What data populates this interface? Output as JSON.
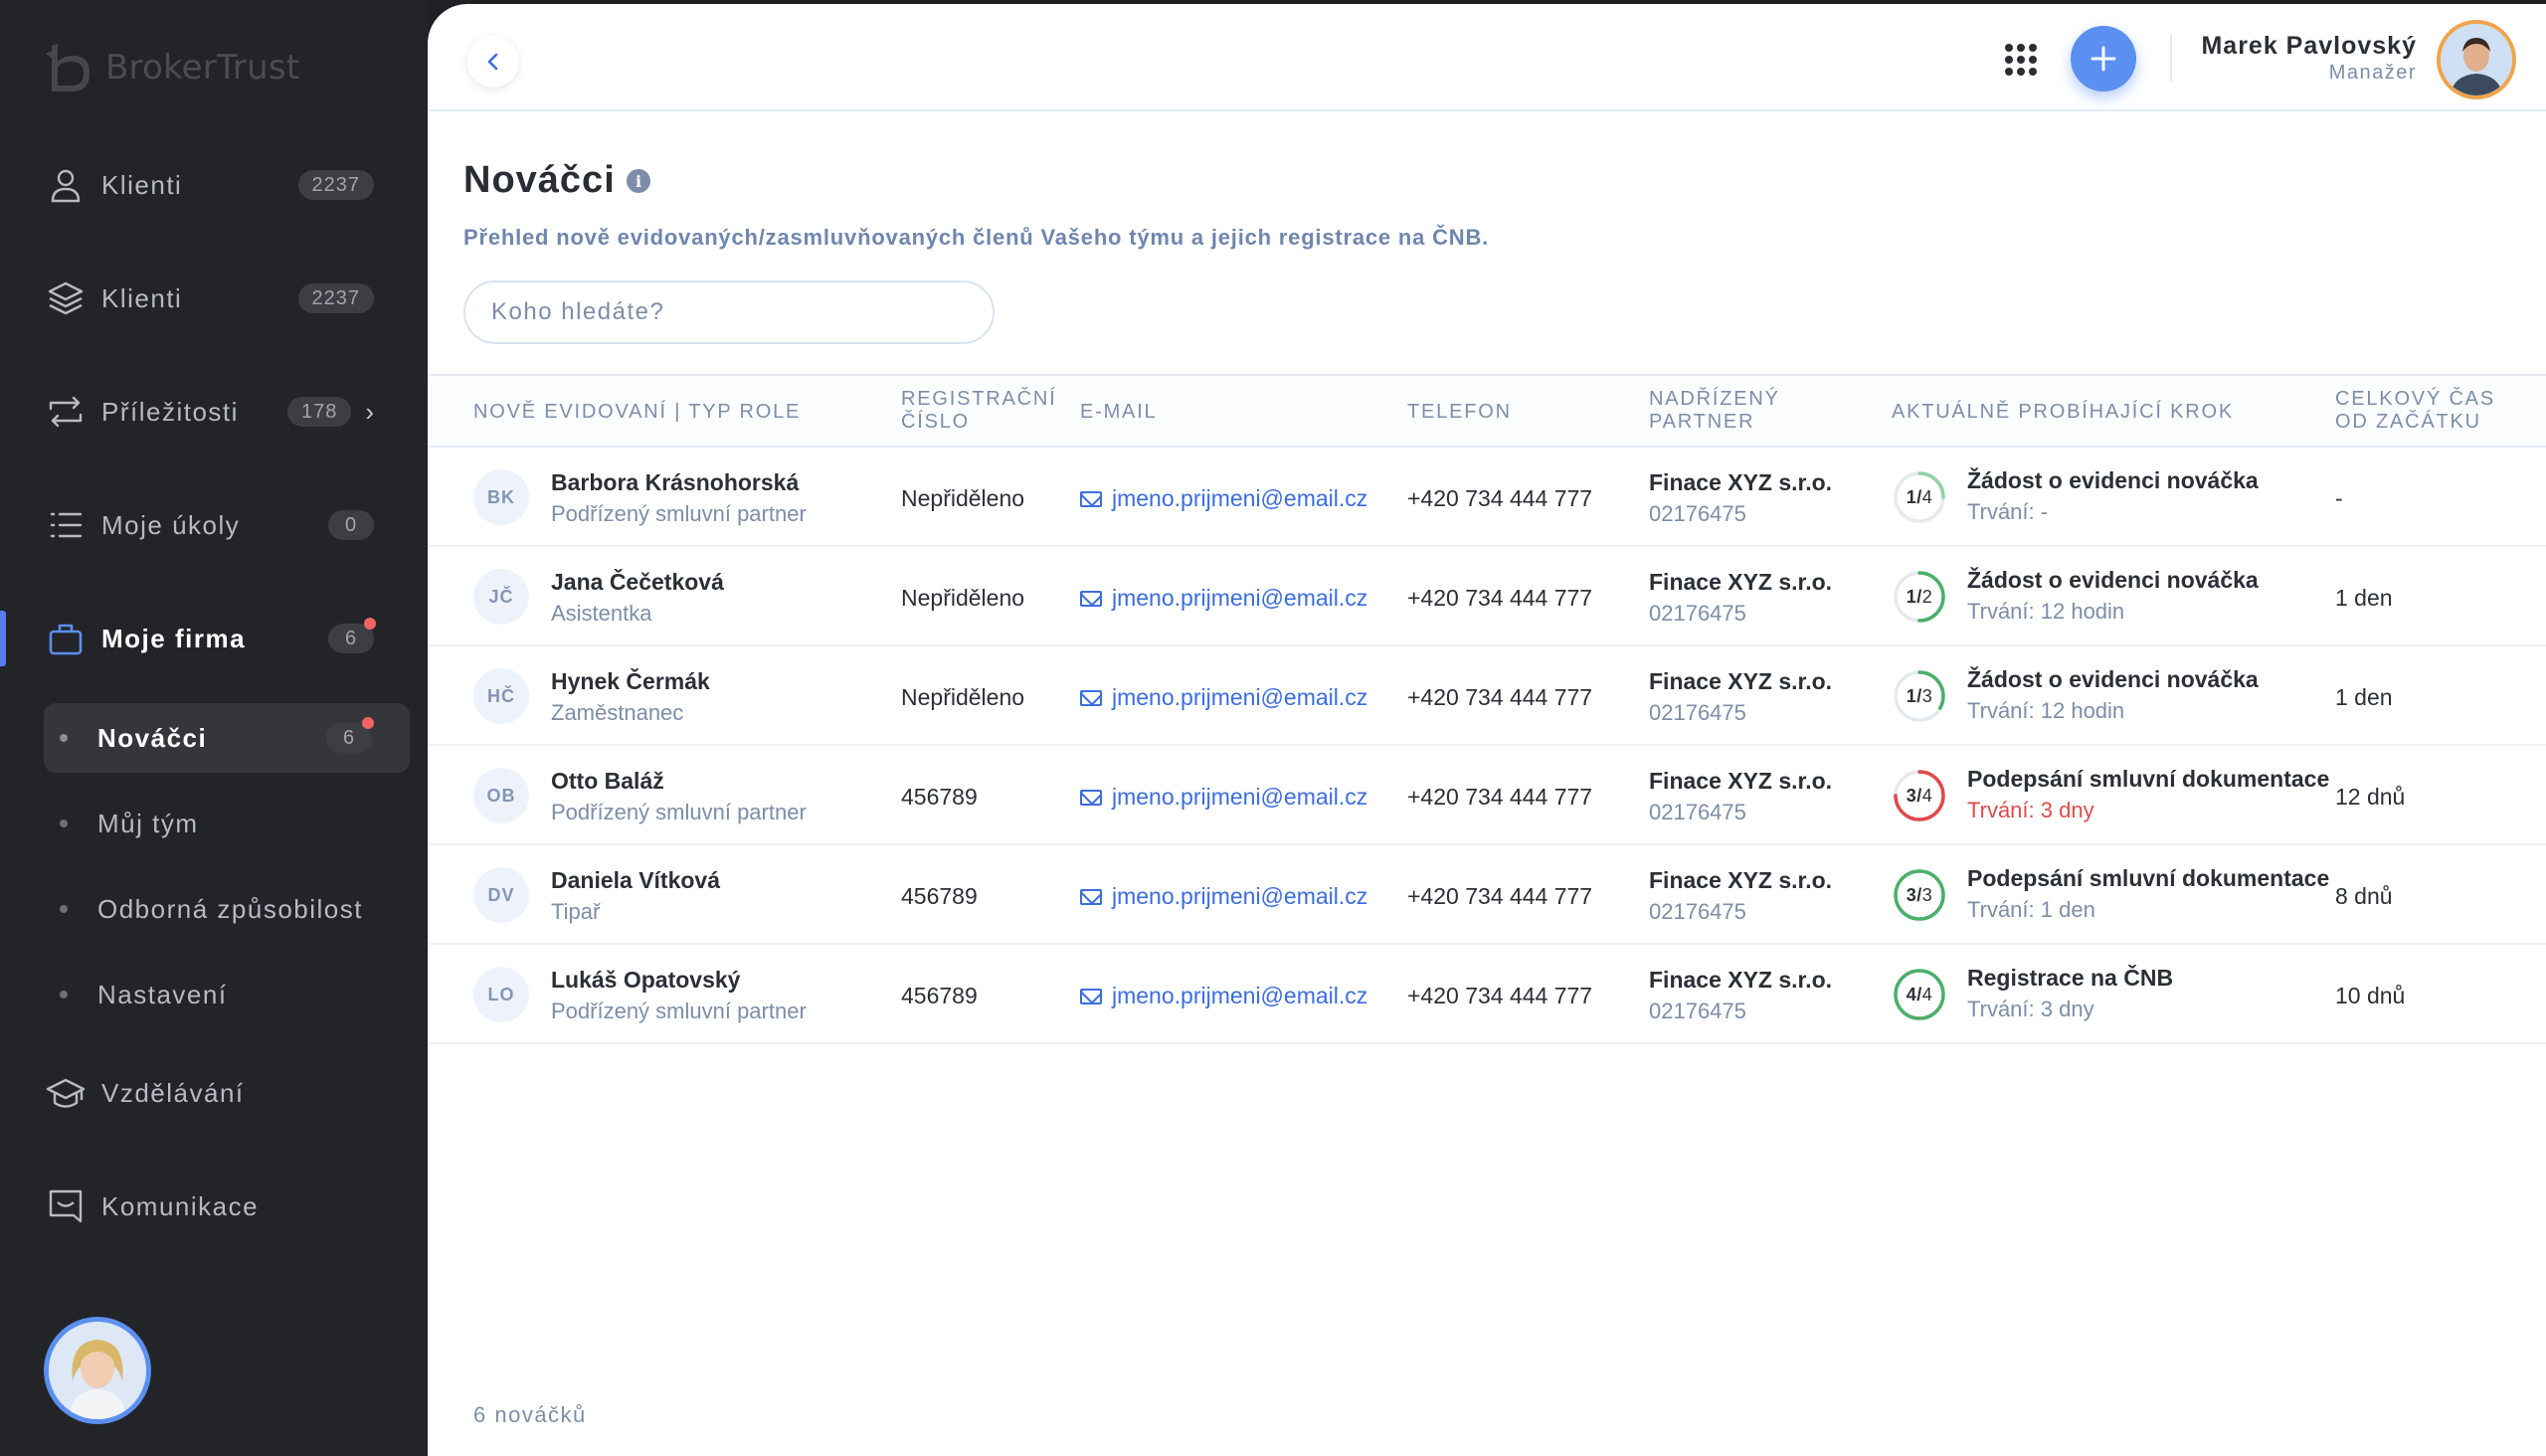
{
  "sidebar": {
    "logo_text": "BrokerTrust",
    "items": [
      {
        "label": "Klienti",
        "badge": "2237",
        "icon": "user-icon"
      },
      {
        "label": "Klienti",
        "badge": "2237",
        "icon": "layers-icon"
      },
      {
        "label": "Příležitosti",
        "badge": "178",
        "icon": "repeat-icon"
      },
      {
        "label": "Moje úkoly",
        "badge": "0",
        "icon": "list-icon"
      },
      {
        "label": "Moje firma",
        "badge": "6",
        "icon": "briefcase-icon"
      }
    ],
    "sub_items": [
      {
        "label": "Nováčci",
        "badge": "6"
      },
      {
        "label": "Můj tým"
      },
      {
        "label": "Odborná způsobilost"
      },
      {
        "label": "Nastavení"
      }
    ],
    "bottom_items": [
      {
        "label": "Vzdělávání",
        "icon": "graduation-cap-icon"
      },
      {
        "label": "Komunikace",
        "icon": "message-icon"
      }
    ]
  },
  "header": {
    "user_name": "Marek Pavlovský",
    "user_role": "Manažer"
  },
  "page": {
    "title": "Nováčci",
    "subtitle": "Přehled nově evidovaných/zasmluvňovaných členů Vašeho týmu a jejich registrace na ČNB.",
    "search_placeholder": "Koho hledáte?",
    "footer_count": "6 nováčků"
  },
  "table": {
    "headers": {
      "name": "Nově evidovaní | typ role",
      "reg_line1": "Registrační",
      "reg_line2": "číslo",
      "email": "E-mail",
      "phone": "Telefon",
      "partner_line1": "Nadřízený",
      "partner_line2": "partner",
      "step": "Aktuálně probíhající krok",
      "total_line1": "Celkový čas",
      "total_line2": "od začátku"
    },
    "rows": [
      {
        "initials": "BK",
        "name": "Barbora Krásnohorská",
        "role": "Podřízený smluvní partner",
        "reg": "Nepřiděleno",
        "email": "jmeno.prijmeni@email.cz",
        "phone": "+420 734 444 777",
        "partner": "Finace XYZ s.r.o.",
        "partner_id": "02176475",
        "step_current": "1",
        "step_total": "4",
        "step_title": "Žádost o evidenci nováčka",
        "step_duration": "Trvání: -",
        "total": "-"
      },
      {
        "initials": "JČ",
        "name": "Jana Čečetková",
        "role": "Asistentka",
        "reg": "Nepřiděleno",
        "email": "jmeno.prijmeni@email.cz",
        "phone": "+420 734 444 777",
        "partner": "Finace XYZ s.r.o.",
        "partner_id": "02176475",
        "step_current": "1",
        "step_total": "2",
        "step_title": "Žádost o evidenci nováčka",
        "step_duration": "Trvání: 12 hodin",
        "total": "1 den"
      },
      {
        "initials": "HČ",
        "name": "Hynek Čermák",
        "role": "Zaměstnanec",
        "reg": "Nepřiděleno",
        "email": "jmeno.prijmeni@email.cz",
        "phone": "+420 734 444 777",
        "partner": "Finace XYZ s.r.o.",
        "partner_id": "02176475",
        "step_current": "1",
        "step_total": "3",
        "step_title": "Žádost o evidenci nováčka",
        "step_duration": "Trvání: 12 hodin",
        "total": "1 den"
      },
      {
        "initials": "OB",
        "name": "Otto Baláž",
        "role": "Podřízený smluvní partner",
        "reg": "456789",
        "email": "jmeno.prijmeni@email.cz",
        "phone": "+420 734 444 777",
        "partner": "Finace XYZ s.r.o.",
        "partner_id": "02176475",
        "step_current": "3",
        "step_total": "4",
        "step_title": "Podepsání smluvní dokumentace",
        "step_duration": "Trvání: 3 dny",
        "total": "12 dnů"
      },
      {
        "initials": "DV",
        "name": "Daniela Vítková",
        "role": "Tipař",
        "reg": "456789",
        "email": "jmeno.prijmeni@email.cz",
        "phone": "+420 734 444 777",
        "partner": "Finace XYZ s.r.o.",
        "partner_id": "02176475",
        "step_current": "3",
        "step_total": "3",
        "step_title": "Podepsání smluvní dokumentace",
        "step_duration": "Trvání: 1 den",
        "total": "8 dnů"
      },
      {
        "initials": "LO",
        "name": "Lukáš Opatovský",
        "role": "Podřízený smluvní partner",
        "reg": "456789",
        "email": "jmeno.prijmeni@email.cz",
        "phone": "+420 734 444 777",
        "partner": "Finace XYZ s.r.o.",
        "partner_id": "02176475",
        "step_current": "4",
        "step_total": "4",
        "step_title": "Registrace na ČNB",
        "step_duration": "Trvání: 3 dny",
        "total": "10 dnů"
      }
    ],
    "ring_colors": [
      "#8fd4a0",
      "#4caf6a",
      "#4caf6a",
      "#e14a4a",
      "#4caf6a",
      "#4caf6a"
    ],
    "alert_rows": [
      3
    ]
  },
  "colors": {
    "accent": "#5b8ff0",
    "link": "#3b6de0",
    "alert": "#e14a4a",
    "success": "#4caf6a",
    "badge_dot": "#f26464"
  }
}
